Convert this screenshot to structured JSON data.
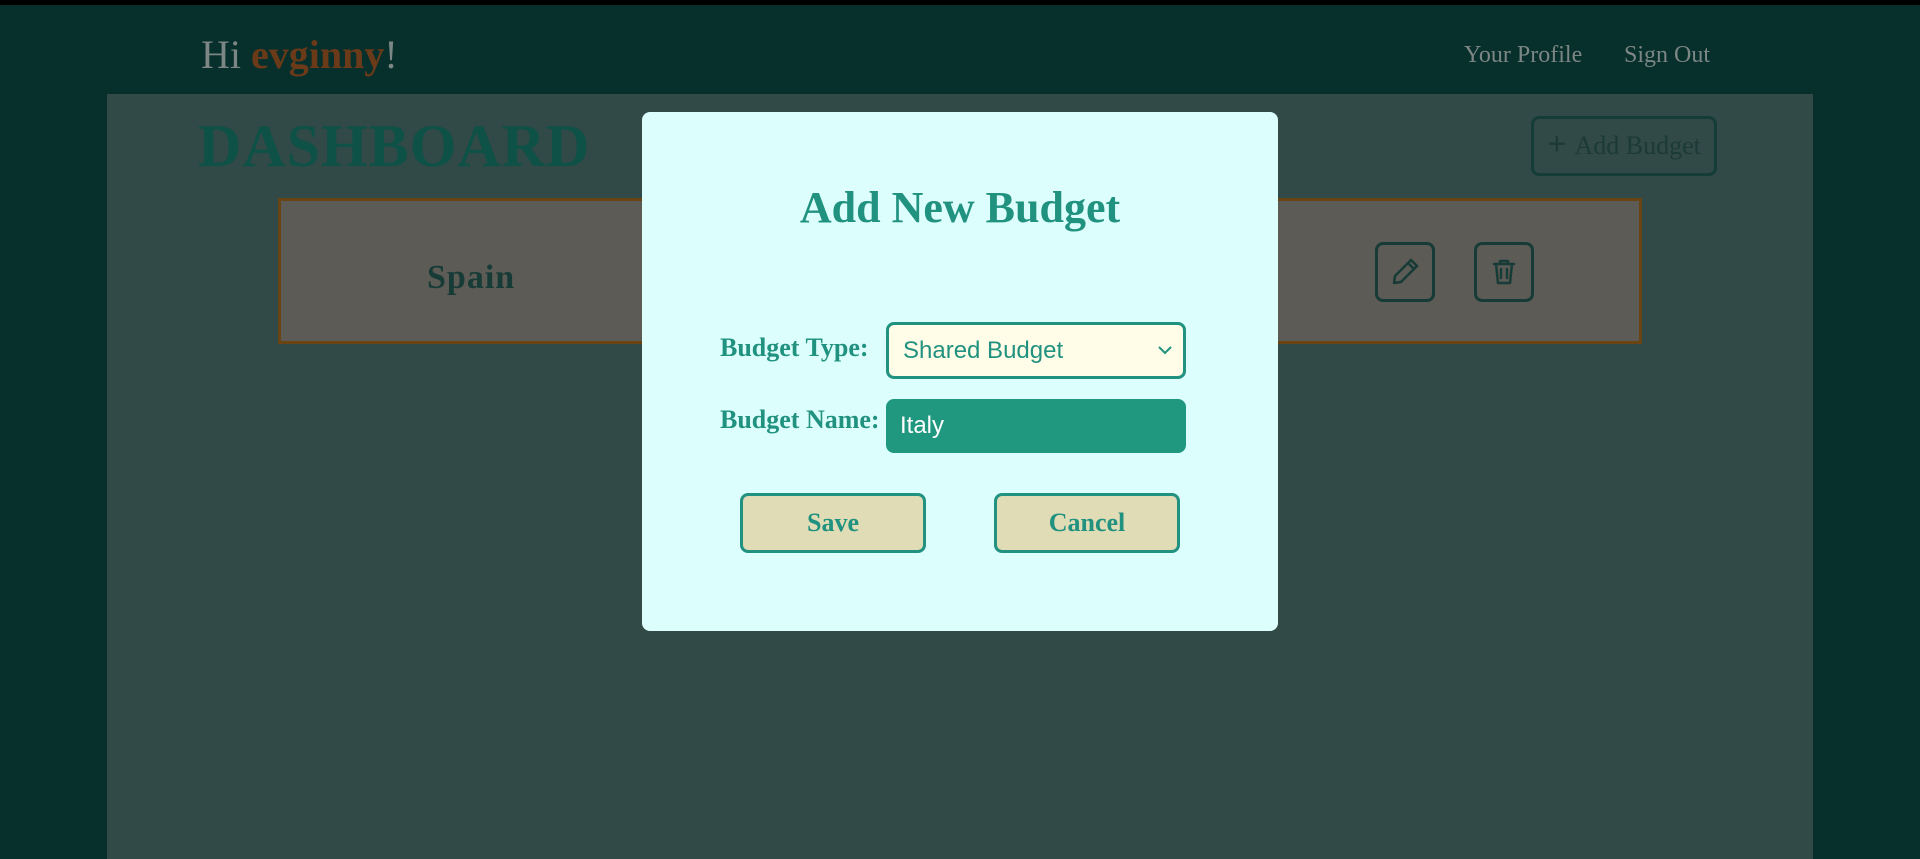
{
  "header": {
    "greeting_prefix": "Hi ",
    "username": "evginny",
    "greeting_suffix": "!",
    "nav": {
      "profile": "Your Profile",
      "signout": "Sign Out"
    }
  },
  "dashboard": {
    "title": "DASHBOARD",
    "add_budget_label": "Add Budget",
    "add_budget_icon": "plus-icon",
    "budgets": [
      {
        "name": "Spain",
        "actions": [
          "pencil-icon",
          "trash-icon"
        ]
      }
    ]
  },
  "modal": {
    "title": "Add New Budget",
    "type_label": "Budget Type:",
    "type_value": "Shared Budget",
    "name_label": "Budget Name:",
    "name_value": "Italy",
    "save_label": "Save",
    "cancel_label": "Cancel"
  },
  "colors": {
    "page_background": "#072f2b",
    "overlay_dim": "#314947",
    "modal_background": "#dcfffd",
    "accent_teal": "#20927f",
    "button_background": "#e0dcb6",
    "select_background": "#fffce8",
    "username_color": "#6b3a18"
  }
}
